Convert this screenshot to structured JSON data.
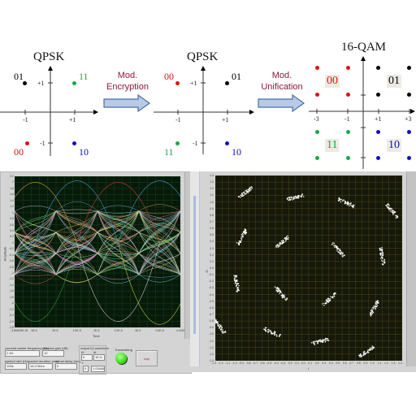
{
  "diagram": {
    "left": {
      "title": "QPSK",
      "points": [
        {
          "label": "01",
          "color": "#000000",
          "i": -1,
          "q": 1
        },
        {
          "label": "11",
          "color": "#1aa64a",
          "i": 1,
          "q": 1
        },
        {
          "label": "00",
          "color": "#e01010",
          "i": -1,
          "q": -1
        },
        {
          "label": "10",
          "color": "#1010c0",
          "i": 1,
          "q": -1
        }
      ],
      "ticks": {
        "x_neg": "-1",
        "x_pos": "+1",
        "y_pos": "+1",
        "y_neg": "-1"
      }
    },
    "arrow1": {
      "line1": "Mod.",
      "line2": "Encryption"
    },
    "middle": {
      "title": "QPSK",
      "points": [
        {
          "label": "00",
          "color": "#e01010",
          "i": -1,
          "q": 1
        },
        {
          "label": "01",
          "color": "#000000",
          "i": 1,
          "q": 1
        },
        {
          "label": "11",
          "color": "#1aa64a",
          "i": -1,
          "q": -1
        },
        {
          "label": "10",
          "color": "#1010c0",
          "i": 1,
          "q": -1
        }
      ],
      "ticks": {
        "x_neg": "-1",
        "x_pos": "+1",
        "y_pos": "+1",
        "y_neg": "-1"
      }
    },
    "arrow2": {
      "line1": "Mod.",
      "line2": "Unification"
    },
    "right": {
      "title": "16-QAM",
      "quadrants": [
        {
          "label": "00",
          "color": "#e01010"
        },
        {
          "label": "01",
          "color": "#000000"
        },
        {
          "label": "11",
          "color": "#1aa64a"
        },
        {
          "label": "10",
          "color": "#1010c0"
        }
      ],
      "ticks": [
        "-3",
        "-1",
        "+1",
        "+3"
      ]
    }
  },
  "eye_panel": {
    "y_axis_label": "Amplitude",
    "x_axis_label": "Time",
    "y_ticks": [
      "2.2",
      "2",
      "1.8",
      "1.6",
      "1.4",
      "1.2",
      "1",
      "0.8",
      "0.6",
      "0.4",
      "0.2",
      "0",
      "-0.2",
      "-0.4",
      "-0.6",
      "-0.8",
      "-1",
      "-1.2",
      "-1.4",
      "-1.6",
      "-1.8",
      "-2",
      "-2.2",
      "-2.4",
      "-2.6",
      "-2.8"
    ],
    "x_ticks": [
      "-3.86805E-18",
      "5E-6",
      "1E-5",
      "1.5E-5",
      "2E-5",
      "2.5E-5",
      "3E-5",
      "3.5E-5",
      "4.0005E-5"
    ],
    "controls": {
      "carrier_freq_label": "coerced carrier frequency (Hz)",
      "carrier_freq_value": "2.4G",
      "gain_label": "coerced gain (dB)",
      "gain_value": "10",
      "symbol_rate_label": "symbol rate (Hz)",
      "symbol_rate_value": "100k",
      "packet_duration_label": "packet duration (sec)",
      "packet_duration_value": "18.2784m",
      "actual_delay_label": "actual delay (sec)",
      "actual_delay_value": "0",
      "output_iq_label": "output IQ waveform",
      "t0_label": "t0",
      "t0_value": "0",
      "dt_label": "dt",
      "dt_value": "1E-6",
      "y_label": "Y",
      "index_value": "0",
      "y_value": "1.03446",
      "transmitting_label": "Transmitting",
      "transmitting_led_color": "#3ee61a",
      "stop_label": "stop"
    }
  },
  "constellation_panel": {
    "y_axis_label": "Q",
    "x_axis_label": "I",
    "y_ticks": [
      "1.4",
      "1.3",
      "1.2",
      "1.1",
      "1.0",
      "0.9",
      "0.8",
      "0.7",
      "0.6",
      "0.5",
      "0.4",
      "0.3",
      "0.2",
      "0.1",
      "0.0",
      "-0.1",
      "-0.2",
      "-0.3",
      "-0.4",
      "-0.5",
      "-0.6",
      "-0.7",
      "-0.8",
      "-0.9",
      "-1.0",
      "-1.1",
      "-1.2",
      "-1.3",
      "-1.4"
    ],
    "x_ticks": [
      "-1.3",
      "-1.2",
      "-1.1",
      "-1.0",
      "-0.9",
      "-0.8",
      "-0.7",
      "-0.6",
      "-0.5",
      "-0.4",
      "-0.3",
      "-0.2",
      "-0.1",
      "0.0",
      "0.1",
      "0.2",
      "0.3",
      "0.4",
      "0.5",
      "0.6",
      "0.7",
      "0.8",
      "0.9",
      "1.0",
      "1.1",
      "1.2",
      "1.3",
      "1.4"
    ],
    "clusters": [
      {
        "i": -0.95,
        "q": 1.14,
        "angle": -35
      },
      {
        "i": -0.2,
        "q": 1.07,
        "angle": -15
      },
      {
        "i": 0.56,
        "q": 0.99,
        "angle": 25
      },
      {
        "i": 1.25,
        "q": 0.86,
        "angle": 50
      },
      {
        "i": -1.0,
        "q": 0.47,
        "angle": -60
      },
      {
        "i": -0.4,
        "q": 0.39,
        "angle": -40
      },
      {
        "i": 0.44,
        "q": 0.28,
        "angle": 50
      },
      {
        "i": 1.1,
        "q": 0.18,
        "angle": 80
      },
      {
        "i": -1.08,
        "q": -0.23,
        "angle": 80
      },
      {
        "i": -0.42,
        "q": -0.38,
        "angle": 50
      },
      {
        "i": 0.31,
        "q": -0.47,
        "angle": -40
      },
      {
        "i": 0.98,
        "q": -0.6,
        "angle": -60
      },
      {
        "i": -1.34,
        "q": -0.88,
        "angle": 50
      },
      {
        "i": -0.55,
        "q": -0.97,
        "angle": 25
      },
      {
        "i": 0.17,
        "q": -1.11,
        "angle": -15
      },
      {
        "i": 0.87,
        "q": -1.26,
        "angle": -35
      }
    ]
  }
}
